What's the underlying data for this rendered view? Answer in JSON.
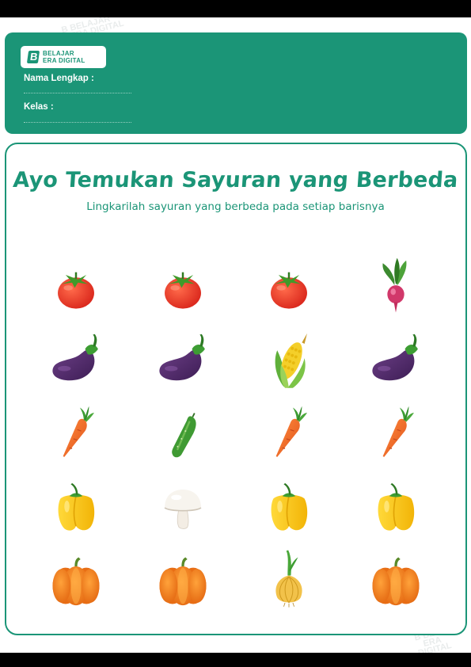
{
  "brand": {
    "line1": "BELAJAR",
    "line2": "ERA DIGITAL",
    "mark": "B"
  },
  "form": {
    "name_label": "Nama Lengkap :",
    "class_label": "Kelas :"
  },
  "worksheet": {
    "title": "Ayo Temukan Sayuran yang Berbeda",
    "instruction": "Lingkarilah sayuran yang berbeda pada setiap barisnya"
  },
  "rows": [
    [
      "tomato-icon",
      "tomato-icon",
      "tomato-icon",
      "radish-icon"
    ],
    [
      "eggplant-icon",
      "eggplant-icon",
      "corn-icon",
      "eggplant-icon"
    ],
    [
      "carrot-icon",
      "cucumber-icon",
      "carrot-icon",
      "carrot-icon"
    ],
    [
      "yellow-pepper-icon",
      "mushroom-icon",
      "yellow-pepper-icon",
      "yellow-pepper-icon"
    ],
    [
      "pumpkin-icon",
      "pumpkin-icon",
      "onion-icon",
      "pumpkin-icon"
    ]
  ],
  "colors": {
    "brand_green": "#1b9577",
    "background": "#ffffff"
  }
}
